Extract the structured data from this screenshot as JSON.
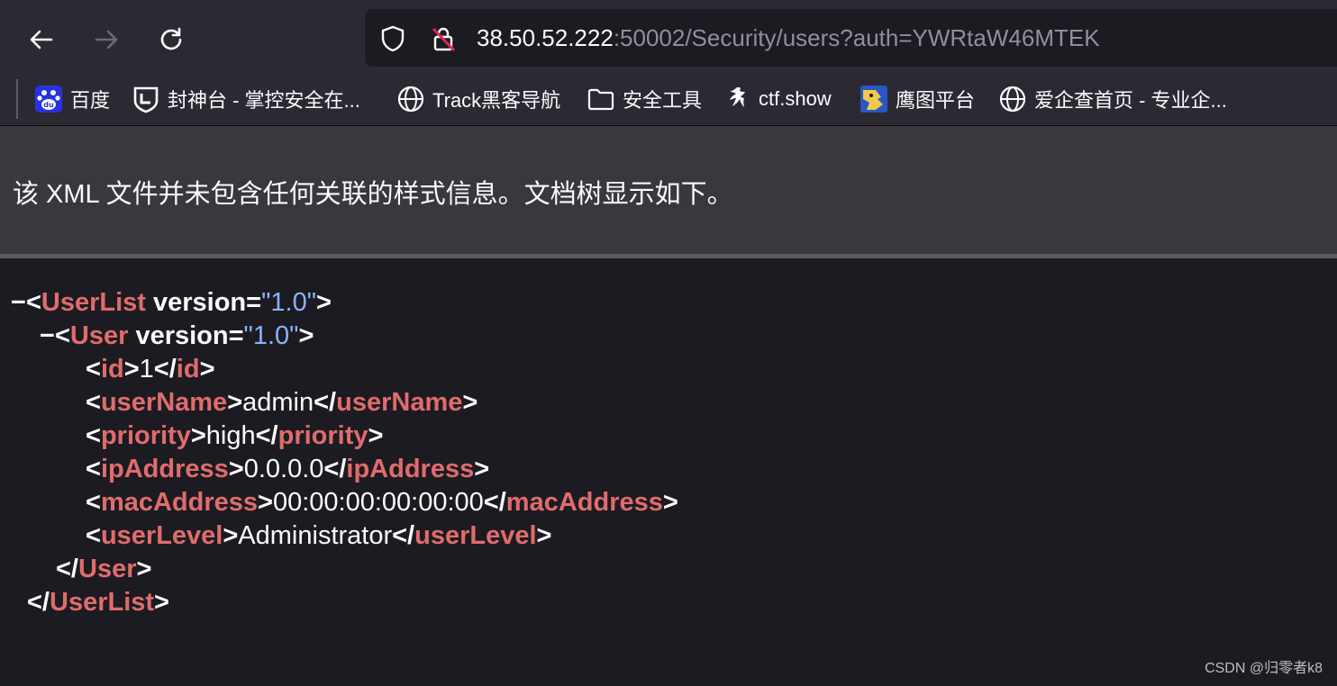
{
  "toolbar": {
    "url_host": "38.50.52.222",
    "url_rest": ":50002/Security/users?auth=YWRtaW46MTEK"
  },
  "bookmarks": [
    {
      "label": "百度",
      "icon": "baidu-icon"
    },
    {
      "label": "封神台 - 掌控安全在...",
      "icon": "fengshentai-icon"
    },
    {
      "label": "Track黑客导航",
      "icon": "globe-icon"
    },
    {
      "label": "安全工具",
      "icon": "folder-icon"
    },
    {
      "label": "ctf.show",
      "icon": "ctfshow-icon"
    },
    {
      "label": "鹰图平台",
      "icon": "hunter-icon"
    },
    {
      "label": "爱企查首页 - 专业企...",
      "icon": "globe-icon"
    }
  ],
  "info": {
    "message": "该 XML 文件并未包含任何关联的样式信息。文档树显示如下。"
  },
  "xml": {
    "root_tag": "UserList",
    "root_attr": "version",
    "root_val": "\"1.0\"",
    "user_tag": "User",
    "user_attr": "version",
    "user_val": "\"1.0\"",
    "fields": [
      {
        "tag": "id",
        "value": "1"
      },
      {
        "tag": "userName",
        "value": "admin"
      },
      {
        "tag": "priority",
        "value": "high"
      },
      {
        "tag": "ipAddress",
        "value": "0.0.0.0"
      },
      {
        "tag": "macAddress",
        "value": "00:00:00:00:00:00"
      },
      {
        "tag": "userLevel",
        "value": "Administrator"
      }
    ],
    "collapse_marker": "−"
  },
  "watermark": "CSDN @归零者k8",
  "colors": {
    "tag": "#e06c6c",
    "attr_value": "#8ab4f8",
    "background": "#1c1b22"
  }
}
